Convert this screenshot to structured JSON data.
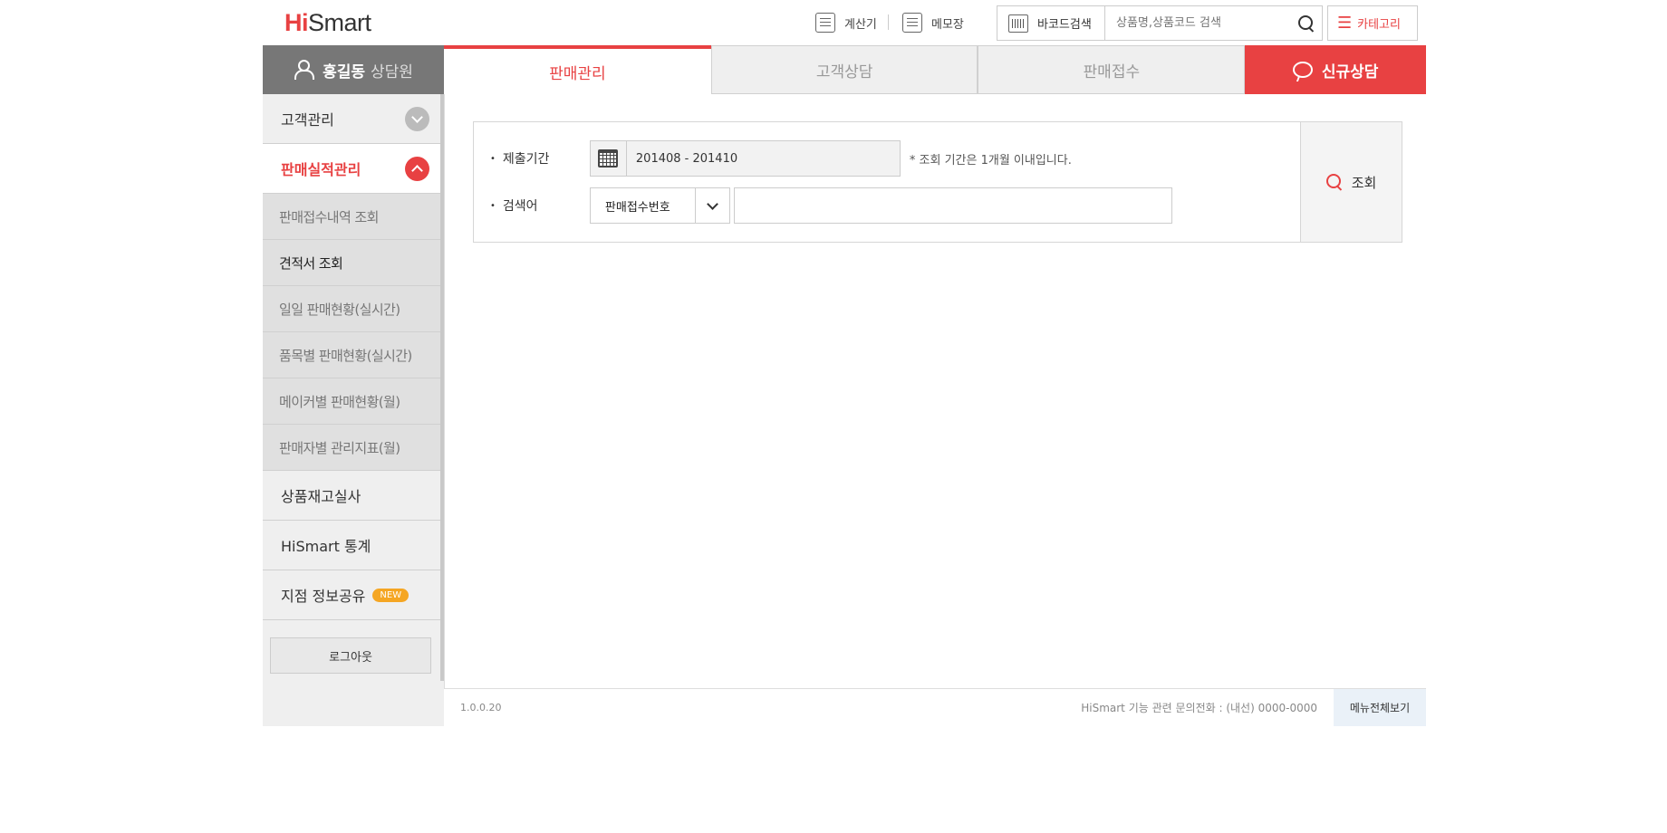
{
  "header": {
    "logo_hi": "Hi",
    "logo_rest": "Smart",
    "calculator_label": "계산기",
    "memo_label": "메모장",
    "barcode_label": "바코드검색",
    "search_placeholder": "상품명,상품코드 검색",
    "category_label": "카테고리"
  },
  "profile": {
    "name": "홍길동",
    "role": "상담원"
  },
  "sidebar": {
    "menu_customer": "고객관리",
    "menu_sales": "판매실적관리",
    "sub_items": [
      "판매접수내역 조회",
      "견적서 조회",
      "일일 판매현황(실시간)",
      "품목별 판매현황(실시간)",
      "메이커별 판매현황(월)",
      "판매자별 관리지표(월)"
    ],
    "menu_inventory": "상품재고실사",
    "menu_stats": "HiSmart 통계",
    "menu_share": "지점 정보공유",
    "new_badge": "NEW",
    "logout": "로그아웃"
  },
  "tabs": {
    "sales": "판매관리",
    "consult": "고객상담",
    "receipt": "판매접수",
    "new_consult": "신규상담"
  },
  "form": {
    "period_label": "제출기간",
    "period_value": "201408 - 201410",
    "period_note": "* 조회 기간은 1개월 이내입니다.",
    "keyword_label": "검색어",
    "keyword_type": "판매접수번호",
    "keyword_value": "",
    "search_button": "조회"
  },
  "footer": {
    "version": "1.0.0.20",
    "contact": "HiSmart 기능 관련 문의전화 : (내선) 0000-0000",
    "all_menu": "메뉴전체보기"
  },
  "colors": {
    "accent": "#e84142",
    "sidebar_bg": "#efefef",
    "profile_bg": "#777777",
    "badge": "#f5a623"
  }
}
